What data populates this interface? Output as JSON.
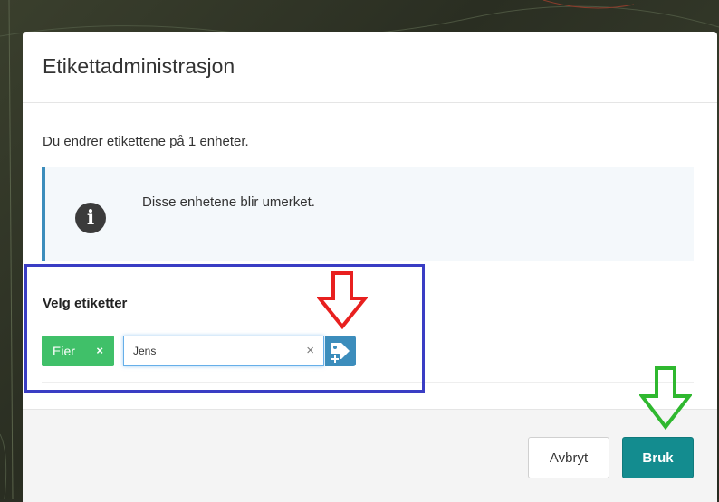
{
  "dialog": {
    "title": "Etikettadministrasjon",
    "intro": "Du endrer etikettene på 1 enheter.",
    "info": {
      "icon": "info-icon",
      "text": "Disse enhetene blir umerket."
    },
    "select_label": "Velg etiketter",
    "selected_tags": [
      {
        "label": "Eier",
        "remove_glyph": "×"
      }
    ],
    "tag_input": {
      "value": "Jens",
      "clear_glyph": "×",
      "add_button_icon": "add-tag-icon"
    }
  },
  "footer": {
    "cancel_label": "Avbryt",
    "apply_label": "Bruk"
  },
  "annotations": {
    "highlight_color": "#3a3dc4",
    "red_arrow_color": "#e8201f",
    "green_arrow_color": "#2fb82f"
  },
  "colors": {
    "tag_green": "#40c069",
    "accent_blue": "#3c8dbc",
    "apply_teal": "#138c8f"
  }
}
